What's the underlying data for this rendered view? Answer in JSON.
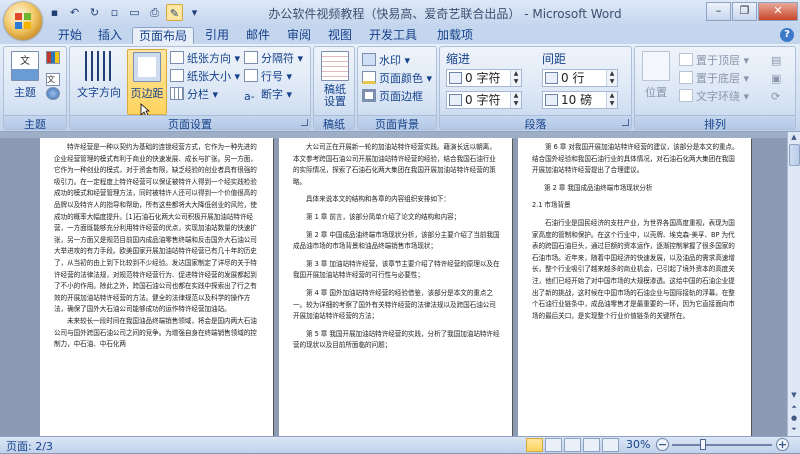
{
  "window": {
    "title": "办公软件视频教程（快易高、爱奇艺联合出品） - Microsoft Word",
    "controls": [
      "minimize",
      "maximize",
      "close"
    ]
  },
  "quick_access": [
    "save-icon",
    "undo-icon",
    "redo-icon",
    "new-icon",
    "open-icon",
    "print-preview-icon",
    "format-painter-icon",
    "dropdown-icon"
  ],
  "tabs": [
    "开始",
    "插入",
    "页面布局",
    "引用",
    "邮件",
    "审阅",
    "视图",
    "开发工具",
    "加载项"
  ],
  "active_tab": "页面布局",
  "ribbon": {
    "theme_group": {
      "label": "主题",
      "button": "主题"
    },
    "page_setup": {
      "label": "页面设置",
      "text_direction": "文字方向",
      "margins": "页边距",
      "orientation": "纸张方向",
      "size": "纸张大小",
      "columns": "分栏",
      "breaks": "分隔符",
      "line_numbers": "行号",
      "hyphenation": "断字"
    },
    "manuscript": {
      "label": "稿纸",
      "button": "稿纸\n设置"
    },
    "page_background": {
      "label": "页面背景",
      "watermark": "水印",
      "page_color": "页面颜色",
      "page_borders": "页面边框"
    },
    "paragraph": {
      "label": "段落",
      "indent_title": "缩进",
      "spacing_title": "间距",
      "indent_left": "0 字符",
      "indent_right": "0 字符",
      "spacing_before": "0 行",
      "spacing_after": "10 磅"
    },
    "arrange": {
      "label": "排列",
      "position": "位置",
      "bring_front": "置于顶层",
      "send_back": "置于底层",
      "text_wrap": "文字环绕"
    }
  },
  "pages": [
    {
      "paragraphs": [
        "特许经营是一种以契约为基础的连锁经营方式，它作为一种先进的企业经营管理的模式有利于商业的快速发展、成长与扩张。另一方面，它作为一种创业的模式，对于资金有限，缺乏经验的创业者具有很强的吸引力。在一定程度上特许经营可以保证被特许人得到一个经实践检验成功的模式和经营管理方法，同时被特许人还可以得到一个价值很高的品牌以及特许人的指导和帮助，所有这些都将大大降低创业的风险，使成功的概率大幅度提升。[1]石油石化两大公司积极开展加油站特许经营，一方面既能够充分利用特许经营的优点，实现加油站数量的快速扩张，另一方面又是规范目前国内成品油零售终端和反击国外大石油公司大举进攻的有力手段。欧美国家开展加油站特许经营已有几十年的历史了，从当初的由上到下比较到不少经验。发达国家制定了详尽的关于特许经营的法律法规，对规范特许经营行为、促进特许经营的发展都起到了不小的作用。除此之外，跨国石油公司也都在实践中探索出了行之有效的开展加油站特许经营的方法。健全的法律规范以及科学的操作方法，确保了国外大石油公司能够成功的运作特许经营加油站。",
        "未来较长一段时间在我国油品终端销售领域，将会是国内两大石油公司与国外跨国石油公司之间的竞争。为增强自身在终端销售领域的控制力，中石油、中石化两"
      ]
    },
    {
      "paragraphs": [
        "大公司正在开展新一轮的加油站特许经营实践。藉演长远以朝离，本文参考跨国石油公司开展加油站特许经营的经验，结合我国石油行业的实际情况，探索了石油石化两大集团在我国开展加油站特许经营的策略。",
        "具体来说本文的结构和各章的内容组织安排如下：",
        "第 1 章  前言，该部分简单介绍了论文的结构和内容；",
        "第 2 章  中国成品油终端市场现状分析，该部分主要介绍了当前我国成品油市场的市场背景和油品终端销售市场现状；",
        "第 3 章  加油站特许经营，该章节主要介绍了特许经营的原理以及在我国开展加油站特许经营的可行性与必要性；",
        "第 4 章  国外加油站特许经营的经验借鉴，该部分是本文的重点之一。较为详细的考察了国外有关特许经营的法律法规以及跨国石油公司开展加油站特许经营的方法；",
        "第 5 章  我国开展加油站特许经营的实践，分析了我国加油站特许经营的现状以及目前所面临的问题；"
      ]
    },
    {
      "paragraphs": [
        "第 6 章  对我国开展加油站特许经营的建议，该部分是本文的重点。结合国外经验和我国石油行业的具体情况，对石油石化两大集团在我国开展加油站特许经营提出了合理建议。",
        "第 2 章  我国成品油终端市场现状分析",
        "2.1  市场背景",
        "石油行业是国民经济的支柱产业，为世界各国高度重视，表现为国家高度的管制和保护。在这个行业中，以壳牌、埃克森-美孚、BP 为代表的跨国石油巨头，通过巨额的资本运作，逐渐控制掌握了很多国家的石油市场。近年来，随着中国经济的快速发展，以及油品的需求高速增长，整个行业吸引了越来越多的商业机会，已引起了境外资本的高度关注，他们已经开始了对中国市场的大规模渗透。这给中国的石油企业提出了新的挑战，这时候在中国市场的石油企业与国际接轨的浮幕。在整个石油行业链条中，成品油零售才是最重要的一环，因为它直接面向市场的最后关口，是实现整个行业价值链条的关键所在。"
      ]
    }
  ],
  "status": {
    "page": "页面: 2/3",
    "zoom": "30%"
  },
  "colors": {
    "ribbon_top": "#e7eef8",
    "workspace": "#8c9ab3",
    "accent": "#15428b",
    "highlight": "#ffd35e"
  }
}
